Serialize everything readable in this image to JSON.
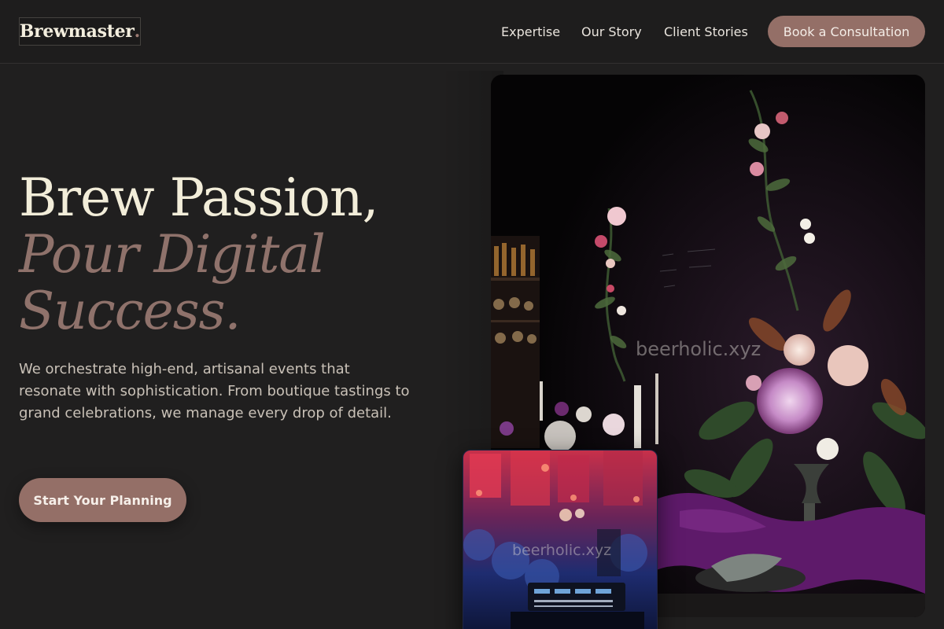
{
  "header": {
    "logo": {
      "text": "Brewmaster",
      "dot": "."
    },
    "nav": [
      {
        "label": "Expertise"
      },
      {
        "label": "Our Story"
      },
      {
        "label": "Client Stories"
      }
    ],
    "cta_label": "Book a Consultation"
  },
  "hero": {
    "headline_line1": "Brew Passion,",
    "headline_line2": "Pour Digital",
    "headline_line3": "Success.",
    "intro": "We orchestrate high-end, artisanal events that resonate with sophistication. From boutique tastings to grand celebrations, we manage every drop of detail.",
    "button_label": "Start Your Planning"
  },
  "images": {
    "main_watermark": "beerholic.xyz",
    "inset_watermark": "beerholic.xyz"
  },
  "colors": {
    "background": "#201f1f",
    "accent": "#946f67",
    "headline": "#f2edd9",
    "headline_accent": "#8f726b",
    "body_text": "#c9c1b7"
  }
}
